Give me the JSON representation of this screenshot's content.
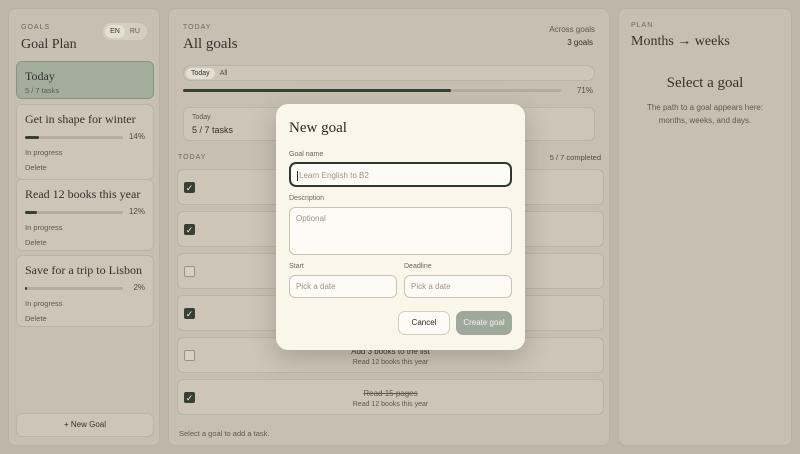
{
  "sidebar": {
    "section_label": "GOALS",
    "title": "Goal Plan",
    "languages": [
      "EN",
      "RU"
    ],
    "goals": [
      {
        "title": "Today",
        "sub": "5 / 7 tasks",
        "selected": true
      },
      {
        "title": "Get in shape for winter",
        "progress": 14,
        "pct_label": "14%",
        "status": "In progress",
        "delete": "Delete"
      },
      {
        "title": "Read 12 books this year",
        "progress": 12,
        "pct_label": "12%",
        "status": "In progress",
        "delete": "Delete"
      },
      {
        "title": "Save for a trip to Lisbon",
        "progress": 2,
        "pct_label": "2%",
        "status": "In progress",
        "delete": "Delete"
      }
    ],
    "new_goal": "+ New Goal"
  },
  "center": {
    "section_label": "TODAY",
    "title": "All goals",
    "across_label": "Across goals",
    "across_count": "3 goals",
    "tabs": [
      "Today",
      "All"
    ],
    "progress": 71,
    "progress_label": "71%",
    "summary_label": "Today",
    "summary_value": "5 / 7 tasks",
    "list_label": "TODAY",
    "list_count": "5 / 7 completed",
    "tasks": [
      {
        "done": true,
        "title": "",
        "goal": ""
      },
      {
        "done": true,
        "title": "",
        "goal": ""
      },
      {
        "done": false,
        "title": "",
        "goal": ""
      },
      {
        "done": true,
        "title": "",
        "goal": ""
      },
      {
        "done": false,
        "title": "Add 3 books to the list",
        "goal": "Read 12 books this year"
      },
      {
        "done": true,
        "title": "Read 15 pages",
        "goal": "Read 12 books this year"
      }
    ],
    "footer_hint": "Select a goal to add a task."
  },
  "plan": {
    "section_label": "PLAN",
    "title": "Months → weeks",
    "empty_title": "Select a goal",
    "empty_text": "The path to a goal appears here: months, weeks, and days."
  },
  "modal": {
    "title": "New goal",
    "goal_name_label": "Goal name",
    "goal_name_placeholder": "Learn English to B2",
    "description_label": "Description",
    "description_placeholder": "Optional",
    "start_label": "Start",
    "start_placeholder": "Pick a date",
    "deadline_label": "Deadline",
    "deadline_placeholder": "Pick a date",
    "cancel": "Cancel",
    "create": "Create goal"
  },
  "colors": {
    "accent": "#2f3a2f",
    "selected_card": "#a9b7a6",
    "create_button": "#9ea99b"
  }
}
